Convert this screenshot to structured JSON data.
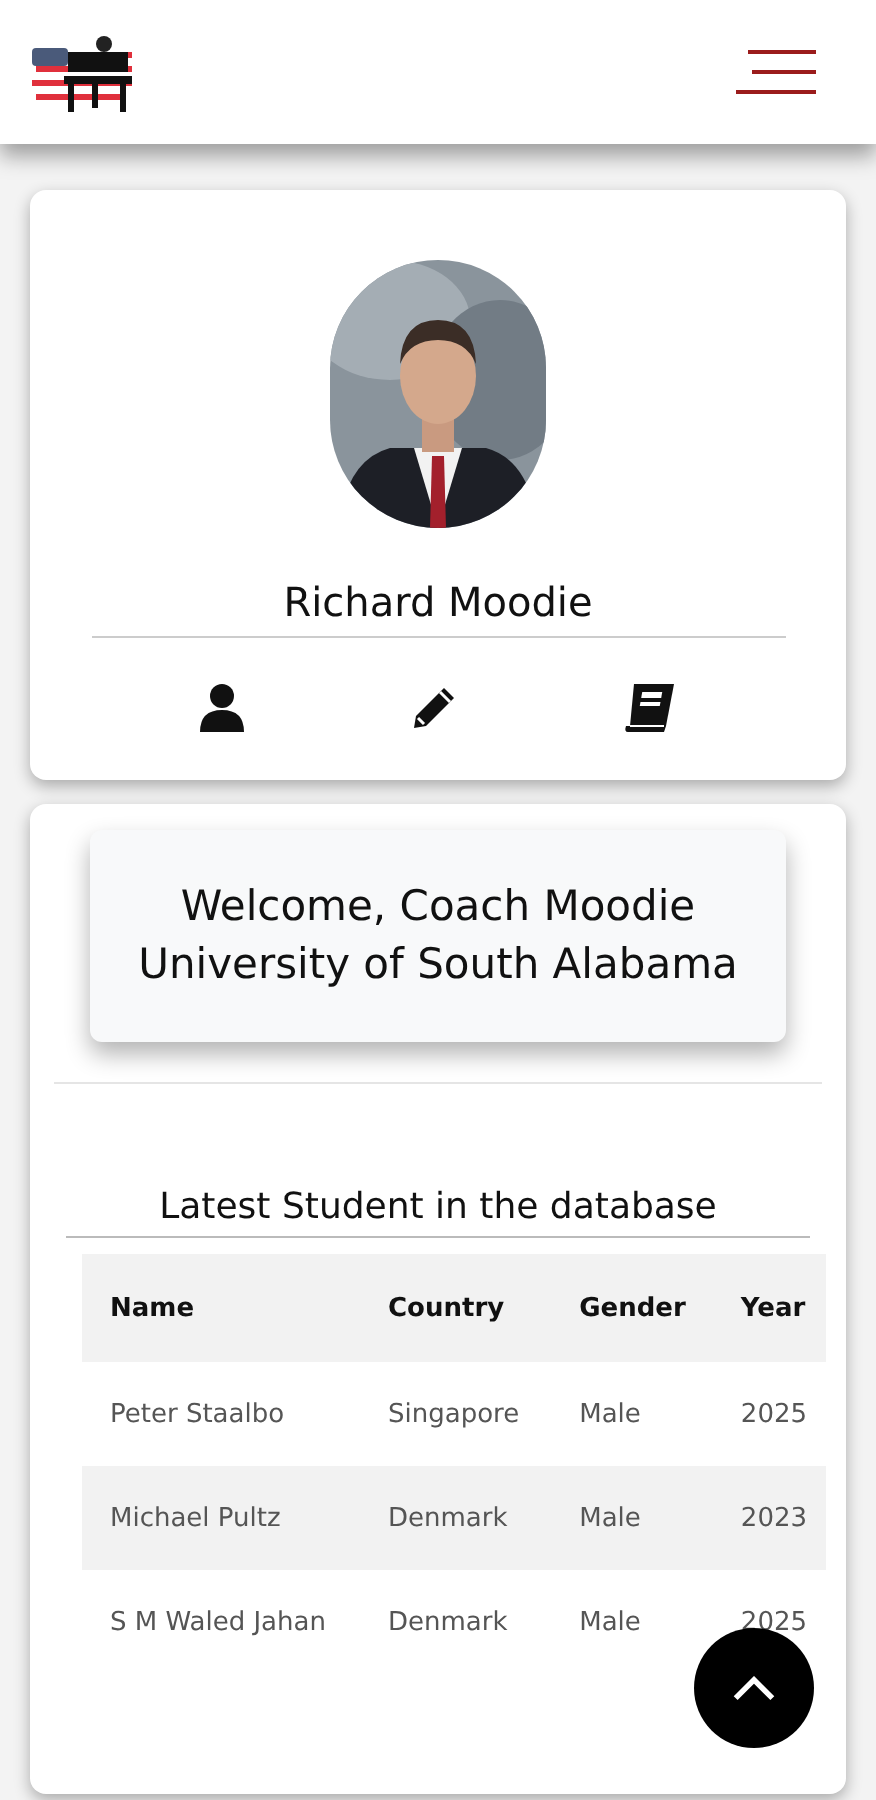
{
  "profile": {
    "name": "Richard Moodie"
  },
  "welcome": {
    "lines": [
      "Welcome, Coach Moodie",
      "University of South Alabama"
    ]
  },
  "students": {
    "title": "Latest Student in the database",
    "columns": [
      "Name",
      "Country",
      "Gender",
      "Year"
    ],
    "rows": [
      [
        "Peter Staalbo",
        "Singapore",
        "Male",
        "2025"
      ],
      [
        "Michael Pultz",
        "Denmark",
        "Male",
        "2023"
      ],
      [
        "S M Waled Jahan",
        "Denmark",
        "Male",
        "2025"
      ]
    ]
  }
}
